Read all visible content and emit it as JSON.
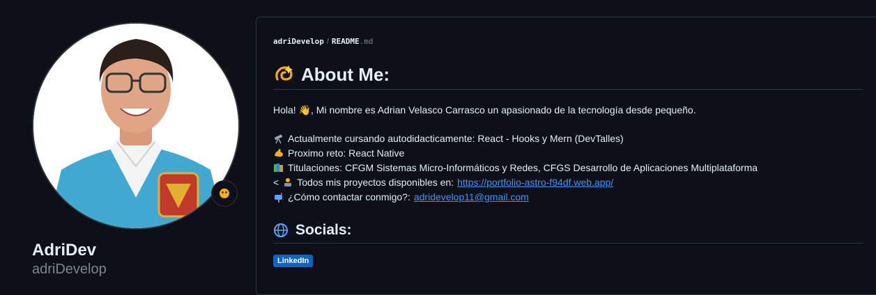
{
  "profile": {
    "display_name": "AdriDev",
    "username": "adriDevelop"
  },
  "readme": {
    "owner": "adriDevelop",
    "separator": "/",
    "file_name": "README",
    "file_ext": ".md",
    "about_heading": "About Me:",
    "intro_text": "Hola! 👋, Mi nombre es Adrian Velasco Carrasco un apasionado de la tecnología desde pequeño.",
    "items": [
      {
        "icon": "telescope-icon",
        "text": "Actualmente cursando autodidacticamente: React - Hooks y Mern (DevTalles)"
      },
      {
        "icon": "flexed-biceps-icon",
        "text": "Proximo reto: React Native"
      },
      {
        "icon": "books-icon",
        "text": "Titulaciones: CFGM Sistemas Micro-Informáticos y Redes, CFGS Desarrollo de Aplicaciones Multiplataforma"
      }
    ],
    "projects_prefix": "<",
    "projects_text": "Todos mis proyectos disponibles en:",
    "projects_link": "https://portfolio-astro-f94df.web.app/",
    "contact_text": "¿Cómo contactar conmigo?:",
    "contact_link": "adridevelop11@gmail.com",
    "socials_heading": "Socials:",
    "linkedin_badge": "LinkedIn"
  },
  "colors": {
    "background": "#0d1117",
    "border": "#30363d",
    "link": "#4493f8",
    "linkedin": "#0a66c2",
    "muted": "#7d8590"
  }
}
